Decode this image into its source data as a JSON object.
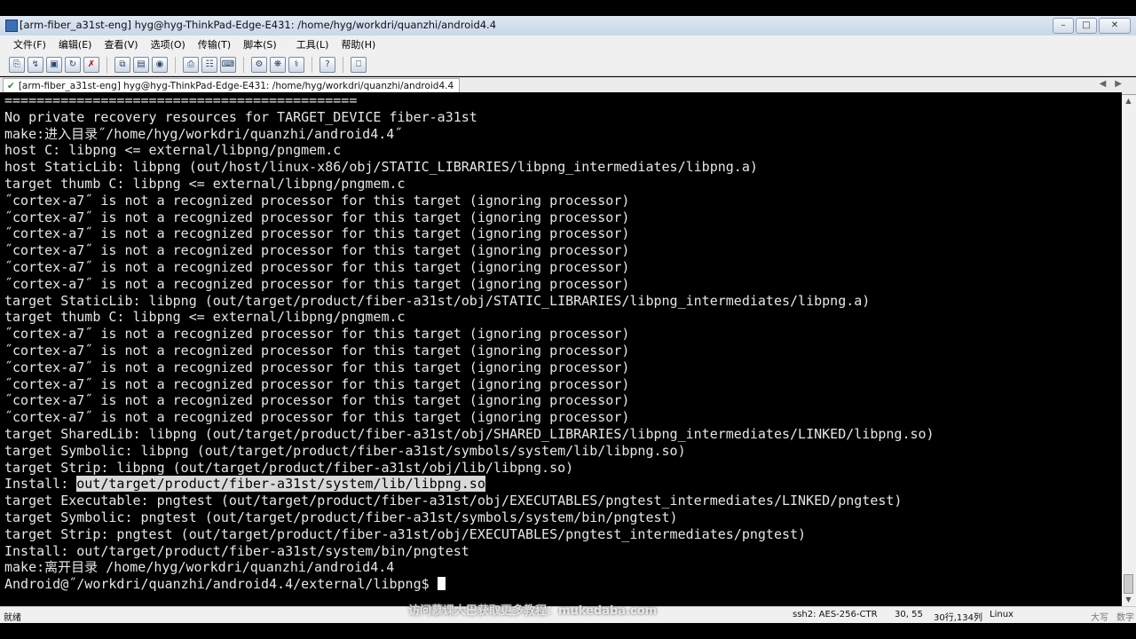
{
  "window": {
    "title": "[arm-fiber_a31st-eng] hyg@hyg-ThinkPad-Edge-E431: /home/hyg/workdri/quanzhi/android4.4",
    "controls": [
      "minimize-icon",
      "maximize-icon",
      "close-icon"
    ]
  },
  "menu": [
    {
      "label": "文件(F)"
    },
    {
      "label": "编辑(E)"
    },
    {
      "label": "查看(V)"
    },
    {
      "label": "选项(O)"
    },
    {
      "label": "传输(T)"
    },
    {
      "label": "脚本(S)"
    },
    {
      "label": "工具(L)"
    },
    {
      "label": "帮助(H)"
    }
  ],
  "toolbar": {
    "icons": [
      "connect-icon",
      "quick-connect-icon",
      "connect-tab-icon",
      "reconnect-icon",
      "disconnect-icon",
      "copy-icon",
      "paste-icon",
      "find-icon",
      "print-icon",
      "print-setup-icon",
      "print-selection-icon",
      "session-options-icon",
      "global-options-icon",
      "keymap-icon",
      "help-icon",
      "lock-icon"
    ]
  },
  "tab": {
    "label": "[arm-fiber_a31st-eng] hyg@hyg-ThinkPad-Edge-E431: /home/hyg/workdri/quanzhi/android4.4"
  },
  "terminal": {
    "lines": [
      "============================================",
      "No private recovery resources for TARGET_DEVICE fiber-a31st",
      "make:进入目录˝/home/hyg/workdri/quanzhi/android4.4˝",
      "host C: libpng <= external/libpng/pngmem.c",
      "host StaticLib: libpng (out/host/linux-x86/obj/STATIC_LIBRARIES/libpng_intermediates/libpng.a)",
      "target thumb C: libpng <= external/libpng/pngmem.c",
      "˝cortex-a7˝ is not a recognized processor for this target (ignoring processor)",
      "˝cortex-a7˝ is not a recognized processor for this target (ignoring processor)",
      "˝cortex-a7˝ is not a recognized processor for this target (ignoring processor)",
      "˝cortex-a7˝ is not a recognized processor for this target (ignoring processor)",
      "˝cortex-a7˝ is not a recognized processor for this target (ignoring processor)",
      "˝cortex-a7˝ is not a recognized processor for this target (ignoring processor)",
      "target StaticLib: libpng (out/target/product/fiber-a31st/obj/STATIC_LIBRARIES/libpng_intermediates/libpng.a)",
      "target thumb C: libpng <= external/libpng/pngmem.c",
      "˝cortex-a7˝ is not a recognized processor for this target (ignoring processor)",
      "˝cortex-a7˝ is not a recognized processor for this target (ignoring processor)",
      "˝cortex-a7˝ is not a recognized processor for this target (ignoring processor)",
      "˝cortex-a7˝ is not a recognized processor for this target (ignoring processor)",
      "˝cortex-a7˝ is not a recognized processor for this target (ignoring processor)",
      "˝cortex-a7˝ is not a recognized processor for this target (ignoring processor)",
      "target SharedLib: libpng (out/target/product/fiber-a31st/obj/SHARED_LIBRARIES/libpng_intermediates/LINKED/libpng.so)",
      "target Symbolic: libpng (out/target/product/fiber-a31st/symbols/system/lib/libpng.so)",
      "target Strip: libpng (out/target/product/fiber-a31st/obj/lib/libpng.so)"
    ],
    "install_line": {
      "prefix": "Install: ",
      "highlight": "out/target/product/fiber-a31st/system/lib/libpng.so"
    },
    "lines_after": [
      "target Executable: pngtest (out/target/product/fiber-a31st/obj/EXECUTABLES/pngtest_intermediates/LINKED/pngtest)",
      "target Symbolic: pngtest (out/target/product/fiber-a31st/symbols/system/bin/pngtest)",
      "target Strip: pngtest (out/target/product/fiber-a31st/obj/EXECUTABLES/pngtest_intermediates/pngtest)",
      "Install: out/target/product/fiber-a31st/system/bin/pngtest",
      "make:离开目录 /home/hyg/workdri/quanzhi/android4.4"
    ],
    "prompt": "Android@˝/workdri/quanzhi/android4.4/external/libpng$ "
  },
  "status": {
    "ready": "就绪",
    "cipher": "ssh2: AES-256-CTR",
    "cursor_pos": "30, 55",
    "size": "30行,134列",
    "os": "Linux",
    "caps": "大写",
    "num": "数字"
  },
  "watermark": "访问慕课大巴获取更多教程：mukedaba.com"
}
